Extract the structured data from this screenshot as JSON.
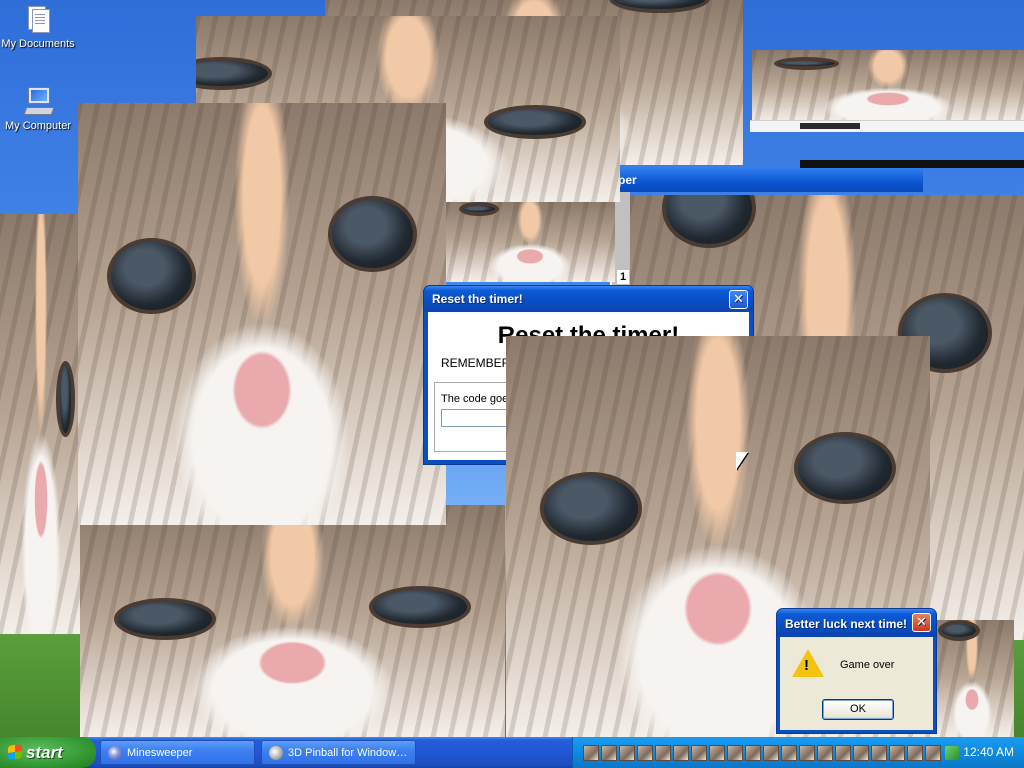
{
  "desktop": {
    "icons": [
      {
        "label": "My Documents",
        "icon": "my-documents-icon"
      },
      {
        "label": "My Computer",
        "icon": "my-computer-icon"
      }
    ]
  },
  "windows": {
    "reset_timer": {
      "title": "Reset the timer!",
      "heading": "Reset the timer!",
      "remember_text": "REMEMBER:",
      "code_label": "The code goe",
      "code_value": ""
    },
    "minesweeper_fragment": {
      "title_fragment": "per",
      "digit": "1"
    },
    "game_over": {
      "title": "Better luck next time!",
      "message": "Game over",
      "ok_label": "OK",
      "icon": "warning-icon"
    }
  },
  "taskbar": {
    "start_label": "start",
    "buttons": [
      {
        "label": "Minesweeper",
        "icon": "minesweeper-icon"
      },
      {
        "label": "3D Pinball for Window…",
        "icon": "pinball-icon"
      }
    ],
    "tray": {
      "icon_count": 20,
      "tray_icon_name": "kitten-tray-icon",
      "network_icon": "network-icon",
      "clock": "12:40 AM"
    }
  },
  "colors": {
    "xp_blue_title": "#0a4ec4",
    "taskbar_blue": "#245edb",
    "start_green": "#339933",
    "close_red": "#c43c1c"
  }
}
